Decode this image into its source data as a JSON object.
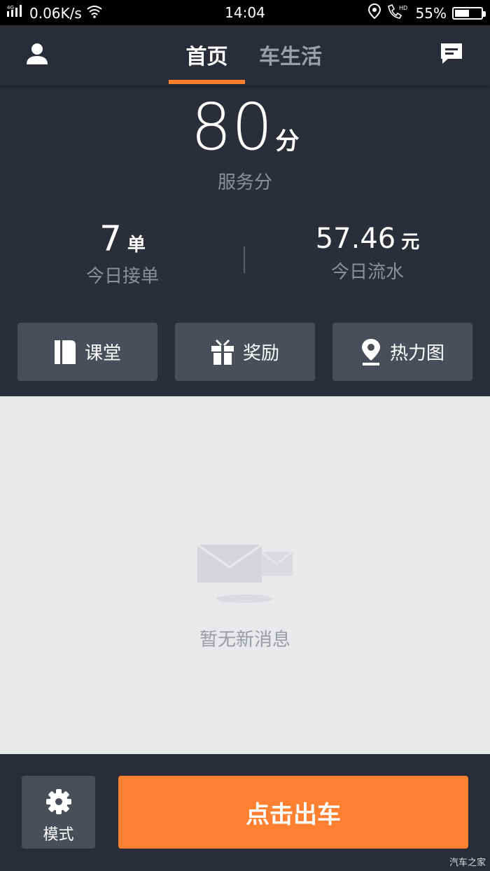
{
  "status_bar": {
    "network": "4G",
    "speed": "0.06K/s",
    "time": "14:04",
    "hd": "HD",
    "battery": "55%",
    "battery_level": 0.55
  },
  "header": {
    "tabs": [
      {
        "label": "首页",
        "active": true
      },
      {
        "label": "车生活",
        "active": false
      }
    ],
    "accent_color": "#ff7f2e"
  },
  "score": {
    "value": "80",
    "unit": "分",
    "label": "服务分"
  },
  "stats": {
    "orders": {
      "value": "7",
      "unit": "单",
      "label": "今日接单"
    },
    "income": {
      "value": "57.46",
      "unit": "元",
      "label": "今日流水"
    }
  },
  "quick_actions": [
    {
      "label": "课堂",
      "icon": "book-icon"
    },
    {
      "label": "奖励",
      "icon": "gift-icon"
    },
    {
      "label": "热力图",
      "icon": "location-pin-icon"
    }
  ],
  "empty_state": {
    "text": "暂无新消息",
    "icon": "envelope-icon"
  },
  "bottom": {
    "mode_label": "模式",
    "go_label": "点击出车",
    "go_color": "#ff8030"
  },
  "watermark": "汽车之家"
}
